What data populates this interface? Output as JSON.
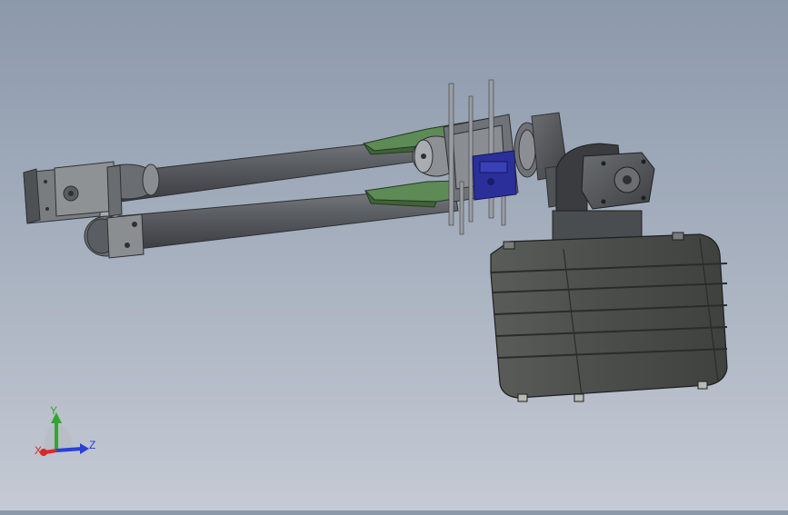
{
  "viewport": {
    "background_top": "#8c99ab",
    "background_bottom": "#c5cad4"
  },
  "triad": {
    "x_label": "X",
    "y_label": "Y",
    "z_label": "Z",
    "x_color": "#d42a2a",
    "y_color": "#2fa82f",
    "z_color": "#2a3fd4"
  },
  "model": {
    "tube_color": "#5b5d62",
    "bracket_color": "#5a8a52",
    "servo_color": "#2a2f9a",
    "case_color": "#4d4f4c",
    "motor_color": "#55585a"
  }
}
